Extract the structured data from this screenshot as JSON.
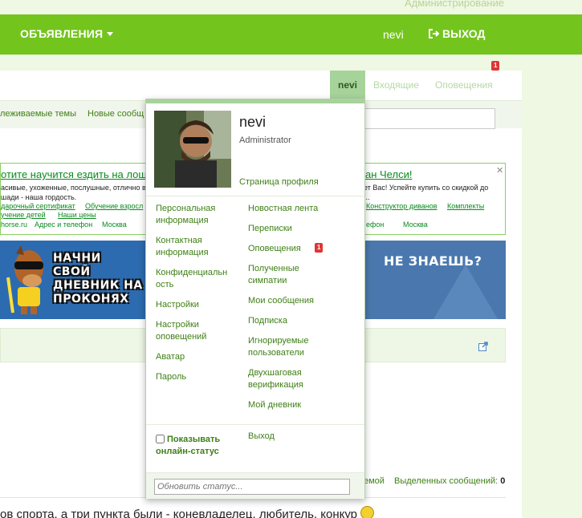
{
  "admin_link": "Администрирование",
  "topbar": {
    "ads_label": "ОБЪЯВЛЕНИЯ",
    "username": "nevi",
    "logout_label": "ВЫХОД"
  },
  "navtabs": {
    "active": "nevi",
    "inbox": "Входящие",
    "alerts": "Оповещения",
    "alerts_count": "1"
  },
  "subnav": {
    "link1": "леживаемые темы",
    "link2": "Новые сообщ"
  },
  "ad": {
    "title_left": "отите научится ездить на лош",
    "title_right": "ан Челси!",
    "text_left_1": "асивые, ухоженные, послушные, отлично в",
    "text_left_2": "шади - наша гордость.",
    "text_right_1": "ет Вас! Успейте купить со скидкой до",
    "links_left_1": [
      "дарочный сертификат",
      "Обучение взросл"
    ],
    "links_left_2": [
      "учение детей",
      "Наши цены"
    ],
    "links_right": [
      "Конструктор диванов",
      "Комплекты"
    ],
    "site_left": "horse.ru",
    "address_left": "Адрес и телефон",
    "city_left": "Москва",
    "address_right": "ефон",
    "city_right": "Москва"
  },
  "banner": {
    "slogan": [
      "НАЧНИ",
      "СВОЙ",
      "ДНЕВНИК НА",
      "ПРОКОНЯХ"
    ],
    "right_text": "НЕ ЗНАЕШЬ?"
  },
  "bottom": {
    "link_left": "емой",
    "selected_label": "Выделенных сообщений:",
    "selected_count": "0",
    "post_text": "ов спорта, а три пункта были - коневладелец, любитель, конкур"
  },
  "dropdown": {
    "name": "nevi",
    "role": "Administrator",
    "profile_link": "Страница профиля",
    "left_items": [
      "Персональная\nинформация",
      "Контактная\nинформация",
      "Конфиденциальн\nость",
      "Настройки",
      "Настройки\nоповещений",
      "Аватар",
      "Пароль"
    ],
    "right_items": [
      "Новостная лента",
      "Переписки",
      "Оповещения",
      "Полученные\nсимпатии",
      "Мои сообщения",
      "Подписка",
      "Игнорируемые\nпользователи",
      "Двухшаговая\nверификация",
      "Мой дневник"
    ],
    "alerts_badge": "1",
    "online_status": "Показывать\nонлайн-статус",
    "logout": "Выход",
    "status_placeholder": "Обновить статус..."
  }
}
